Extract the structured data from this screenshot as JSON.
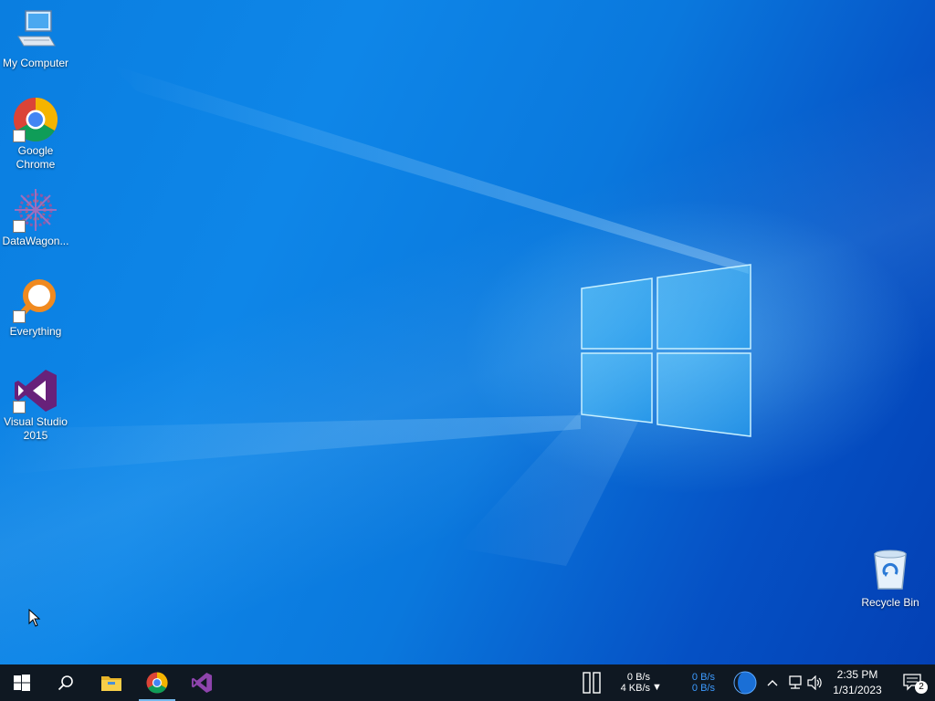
{
  "desktop": {
    "icons": [
      {
        "label": "My Computer"
      },
      {
        "label": "Google Chrome"
      },
      {
        "label": "DataWagon..."
      },
      {
        "label": "Everything"
      },
      {
        "label": "Visual Studio 2015"
      },
      {
        "label": "Recycle Bin"
      }
    ]
  },
  "taskbar": {
    "pinned": [
      "start-icon",
      "search-icon",
      "file-explorer-icon",
      "chrome-icon",
      "visual-studio-icon"
    ],
    "net_monitor_1": {
      "up": "0 B/s",
      "down": "4 KB/s",
      "arrow": "▼"
    },
    "net_monitor_2": {
      "up": "0 B/s",
      "down": "0 B/s"
    },
    "clock": {
      "time": "2:35 PM",
      "date": "1/31/2023"
    },
    "notifications": {
      "count": "2"
    }
  },
  "colors": {
    "desktop_blue": "#0a7ee0",
    "taskbar": "#0f1822",
    "net2_text": "#3d9bff"
  }
}
